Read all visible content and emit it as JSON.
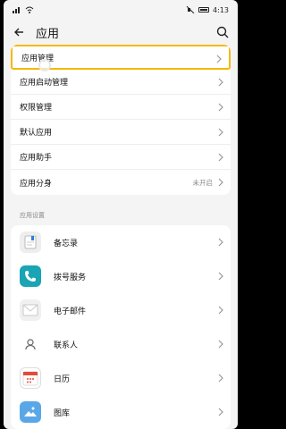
{
  "status": {
    "time": "4:13"
  },
  "header": {
    "title": "应用"
  },
  "menu": [
    {
      "label": "应用管理",
      "value": ""
    },
    {
      "label": "应用启动管理",
      "value": ""
    },
    {
      "label": "权限管理",
      "value": ""
    },
    {
      "label": "默认应用",
      "value": ""
    },
    {
      "label": "应用助手",
      "value": ""
    },
    {
      "label": "应用分身",
      "value": "未开启"
    }
  ],
  "section": {
    "label": "应用设置"
  },
  "apps": [
    {
      "label": "备忘录",
      "icon": "memo-icon"
    },
    {
      "label": "拨号服务",
      "icon": "phone-icon"
    },
    {
      "label": "电子邮件",
      "icon": "email-icon"
    },
    {
      "label": "联系人",
      "icon": "contacts-icon"
    },
    {
      "label": "日历",
      "icon": "calendar-icon"
    },
    {
      "label": "图库",
      "icon": "gallery-icon"
    }
  ],
  "colors": {
    "highlight": "#f5b800",
    "phone": "#1aa4b4",
    "calendar": "#e34b3a"
  }
}
